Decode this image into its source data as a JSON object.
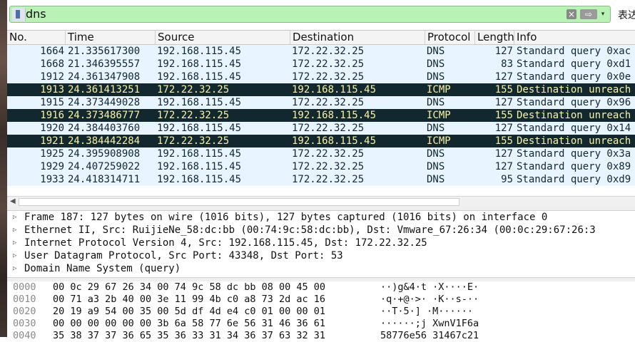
{
  "filter": {
    "value": "dns",
    "expression_label": "表达",
    "clear_icon": "×",
    "apply_icon": "⇨",
    "dropdown_icon": "▾"
  },
  "columns": [
    "No.",
    "Time",
    "Source",
    "Destination",
    "Protocol",
    "Length",
    "Info"
  ],
  "packets": [
    {
      "no": "1664",
      "time": "21.335617300",
      "src": "192.168.115.45",
      "dst": "172.22.32.25",
      "proto": "DNS",
      "len": "127",
      "info": "Standard query 0xac",
      "icmp": false
    },
    {
      "no": "1668",
      "time": "21.346395557",
      "src": "192.168.115.45",
      "dst": "172.22.32.25",
      "proto": "DNS",
      "len": "83",
      "info": "Standard query 0xd1",
      "icmp": false
    },
    {
      "no": "1912",
      "time": "24.361347908",
      "src": "192.168.115.45",
      "dst": "172.22.32.25",
      "proto": "DNS",
      "len": "127",
      "info": "Standard query 0x0e",
      "icmp": false
    },
    {
      "no": "1913",
      "time": "24.361413251",
      "src": "172.22.32.25",
      "dst": "192.168.115.45",
      "proto": "ICMP",
      "len": "155",
      "info": "Destination unreach",
      "icmp": true
    },
    {
      "no": "1915",
      "time": "24.373449028",
      "src": "192.168.115.45",
      "dst": "172.22.32.25",
      "proto": "DNS",
      "len": "127",
      "info": "Standard query 0x96",
      "icmp": false
    },
    {
      "no": "1916",
      "time": "24.373486777",
      "src": "172.22.32.25",
      "dst": "192.168.115.45",
      "proto": "ICMP",
      "len": "155",
      "info": "Destination unreach",
      "icmp": true
    },
    {
      "no": "1920",
      "time": "24.384403760",
      "src": "192.168.115.45",
      "dst": "172.22.32.25",
      "proto": "DNS",
      "len": "127",
      "info": "Standard query 0x14",
      "icmp": false
    },
    {
      "no": "1921",
      "time": "24.384442284",
      "src": "172.22.32.25",
      "dst": "192.168.115.45",
      "proto": "ICMP",
      "len": "155",
      "info": "Destination unreach",
      "icmp": true
    },
    {
      "no": "1925",
      "time": "24.395908908",
      "src": "192.168.115.45",
      "dst": "172.22.32.25",
      "proto": "DNS",
      "len": "127",
      "info": "Standard query 0x3a",
      "icmp": false
    },
    {
      "no": "1929",
      "time": "24.407259022",
      "src": "192.168.115.45",
      "dst": "172.22.32.25",
      "proto": "DNS",
      "len": "127",
      "info": "Standard query 0x89",
      "icmp": false
    },
    {
      "no": "1933",
      "time": "24.418314711",
      "src": "192.168.115.45",
      "dst": "172.22.32.25",
      "proto": "DNS",
      "len": "95",
      "info": "Standard query 0xd9",
      "icmp": false
    }
  ],
  "details": [
    "Frame 187: 127 bytes on wire (1016 bits), 127 bytes captured (1016 bits) on interface 0",
    "Ethernet II, Src: RuijieNe_58:dc:bb (00:74:9c:58:dc:bb), Dst: Vmware_67:26:34 (00:0c:29:67:26:3",
    "Internet Protocol Version 4, Src: 192.168.115.45, Dst: 172.22.32.25",
    "User Datagram Protocol, Src Port: 43348, Dst Port: 53",
    "Domain Name System (query)"
  ],
  "expand_icon": "▷",
  "bytes": [
    {
      "offset": "0000",
      "hex": "00 0c 29 67 26 34 00 74  9c 58 dc bb 08 00 45 00",
      "ascii": "··)g&4·t ·X····E·"
    },
    {
      "offset": "0010",
      "hex": "00 71 a3 2b 40 00 3e 11  99 4b c0 a8 73 2d ac 16",
      "ascii": "·q·+@·>· ·K··s-··"
    },
    {
      "offset": "0020",
      "hex": "20 19 a9 54 00 35 00 5d  df 4d e4 c0 01 00 00 01",
      "ascii": " ··T·5·] ·M······"
    },
    {
      "offset": "0030",
      "hex": "00 00 00 00 00 00 3b 6a  58 77 6e 56 31 46 36 61",
      "ascii": "······;j XwnV1F6a"
    },
    {
      "offset": "0040",
      "hex": "35 38 37 37 36 65 35 36  33 31 34 36 37 63 32 31",
      "ascii": "58776e56 31467c21"
    }
  ],
  "colors": {
    "filter_ok": "#b9f2b5",
    "row_bg": "#e8f4ff",
    "row_fg": "#12272e",
    "icmp_bg": "#12272e",
    "icmp_fg": "#f7f3a8"
  }
}
